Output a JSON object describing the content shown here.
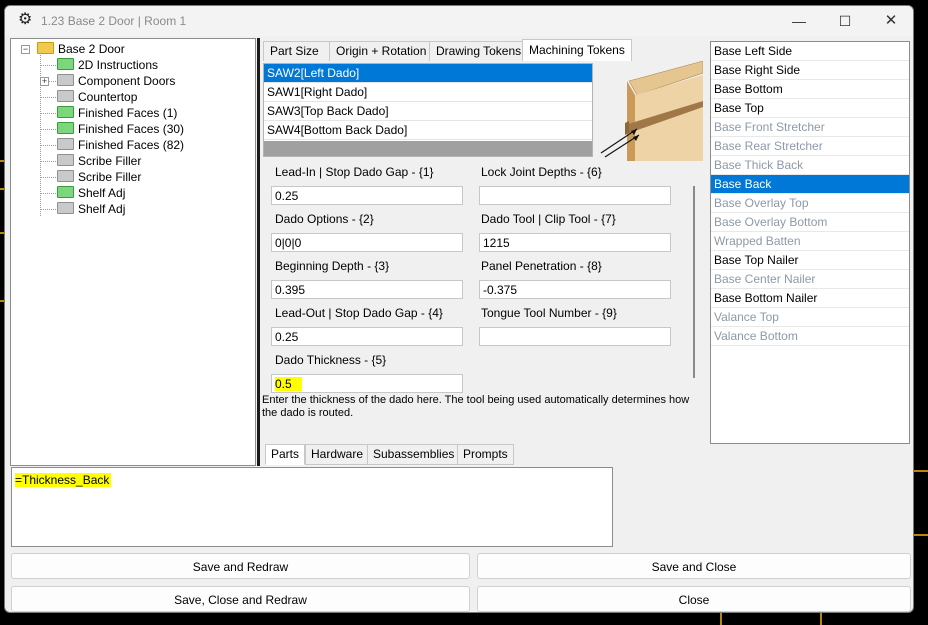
{
  "window": {
    "title": "1.23 Base 2 Door | Room 1"
  },
  "title_controls": {
    "minimize": "—",
    "maximize": "☐",
    "close": "✕"
  },
  "tree": {
    "root": "Base 2 Door",
    "items": [
      {
        "label": "2D Instructions",
        "folder": "green"
      },
      {
        "label": "Component Doors",
        "folder": "gray",
        "expander": "+"
      },
      {
        "label": "Countertop",
        "folder": "gray"
      },
      {
        "label": "Finished Faces (1)",
        "folder": "green"
      },
      {
        "label": "Finished Faces (30)",
        "folder": "green"
      },
      {
        "label": "Finished Faces (82)",
        "folder": "gray"
      },
      {
        "label": "Scribe Filler",
        "folder": "gray"
      },
      {
        "label": "Scribe Filler",
        "folder": "gray"
      },
      {
        "label": "Shelf Adj",
        "folder": "green"
      },
      {
        "label": "Shelf Adj",
        "folder": "gray"
      }
    ]
  },
  "top_tabs": [
    "Part  Size",
    "Origin + Rotation",
    "Drawing Tokens",
    "Machining Tokens"
  ],
  "tokens": [
    "SAW2[Left Dado]",
    "SAW1[Right Dado]",
    "SAW3[Top Back Dado]",
    "SAW4[Bottom Back Dado]"
  ],
  "fields": {
    "lead_in": {
      "label": "Lead-In | Stop Dado Gap - {1}",
      "value": "0.25"
    },
    "dado_options": {
      "label": "Dado Options - {2}",
      "value": "0|0|0"
    },
    "begin_depth": {
      "label": "Beginning Depth - {3}",
      "value": "0.395"
    },
    "lead_out": {
      "label": "Lead-Out | Stop Dado Gap - {4}",
      "value": "0.25"
    },
    "dado_thick": {
      "label": "Dado Thickness - {5}",
      "value": "0.5"
    },
    "lock_joint": {
      "label": "Lock Joint Depths - {6}",
      "value": ""
    },
    "dado_tool": {
      "label": "Dado Tool | Clip Tool - {7}",
      "value": "1215"
    },
    "panel_pen": {
      "label": "Panel Penetration - {8}",
      "value": "-0.375"
    },
    "tongue_tool": {
      "label": "Tongue Tool Number - {9}",
      "value": ""
    }
  },
  "help_text": "Enter the thickness of the dado here. The tool being used automatically determines how the dado is routed.",
  "parts": [
    {
      "label": "Base Left Side",
      "state": "normal"
    },
    {
      "label": "Base Right Side",
      "state": "normal"
    },
    {
      "label": "Base Bottom",
      "state": "normal"
    },
    {
      "label": "Base Top",
      "state": "normal"
    },
    {
      "label": "Base Front Stretcher",
      "state": "disabled"
    },
    {
      "label": "Base Rear Stretcher",
      "state": "disabled"
    },
    {
      "label": "Base Thick Back",
      "state": "disabled"
    },
    {
      "label": "Base Back",
      "state": "selected"
    },
    {
      "label": "Base Overlay Top",
      "state": "disabled"
    },
    {
      "label": "Base Overlay Bottom",
      "state": "disabled"
    },
    {
      "label": "Wrapped Batten",
      "state": "disabled"
    },
    {
      "label": "Base Top Nailer",
      "state": "normal"
    },
    {
      "label": "Base Center Nailer",
      "state": "disabled"
    },
    {
      "label": "Base Bottom Nailer",
      "state": "normal"
    },
    {
      "label": "Valance Top",
      "state": "disabled"
    },
    {
      "label": "Valance Bottom",
      "state": "disabled"
    }
  ],
  "bottom_tabs": [
    "Parts",
    "Hardware",
    "Subassemblies",
    "Prompts"
  ],
  "formula": "=Thickness_Back",
  "buttons": {
    "save_redraw": "Save and Redraw",
    "save_close": "Save and Close",
    "save_close_redraw": "Save, Close and Redraw",
    "close": "Close"
  },
  "colors": {
    "selection": "#0078d7",
    "highlight": "#ffff00",
    "folder_green": "#7cd67c",
    "folder_open": "#f2c94c"
  }
}
